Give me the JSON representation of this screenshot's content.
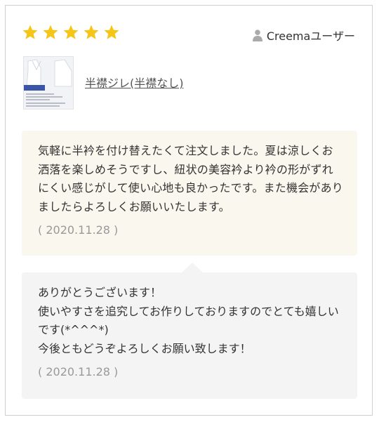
{
  "rating": {
    "stars": 5,
    "max": 5,
    "color": "#f5c518"
  },
  "reviewer": {
    "icon": "user-icon",
    "name": "Creemaユーザー"
  },
  "product": {
    "name": "半襟ジレ(半襟なし)",
    "thumbnail_caption": "国内表さらし"
  },
  "review": {
    "text": "気軽に半衿を付け替えたくて注文しました。夏は涼しくお洒落を楽しめそうですし、紐状の美容衿より衿の形がずれにくい感じがして使い心地も良かったです。また機会がありましたらよろしくお願いいたします。",
    "date": "( 2020.11.28 )",
    "background": "#faf7ee"
  },
  "reply": {
    "text": "ありがとうございます！\n使いやすさを追究してお作りしておりますのでとても嬉しいです(*^^^*)\n今後ともどうぞよろしくお願い致します！",
    "date": "( 2020.11.28 )",
    "background": "#f4f4f4"
  }
}
